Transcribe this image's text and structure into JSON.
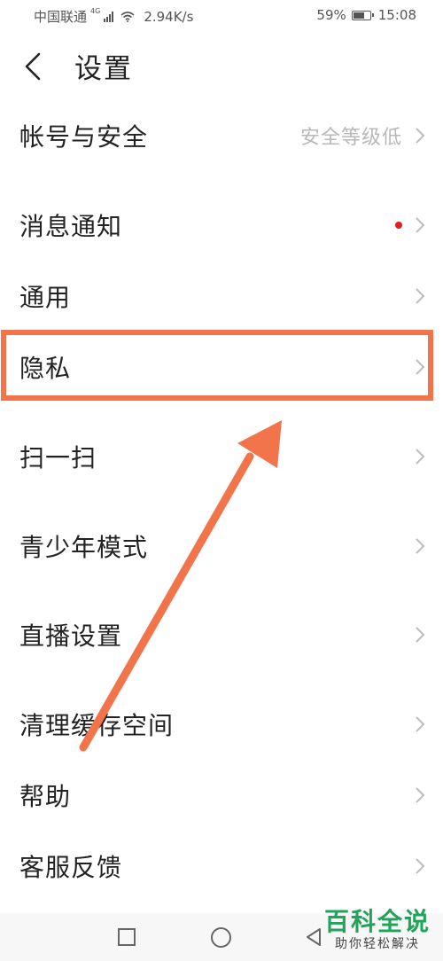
{
  "status_bar": {
    "carrier": "中国联通",
    "network": "4G",
    "speed": "2.94K/s",
    "battery": "59%",
    "time": "15:08"
  },
  "header": {
    "back_icon": "chevron-left-icon",
    "title": "设置"
  },
  "settings": {
    "items": [
      {
        "label": "帐号与安全",
        "value": "安全等级低"
      },
      {
        "label": "消息通知",
        "badge": "red-dot"
      },
      {
        "label": "通用"
      },
      {
        "label": "隐私"
      },
      {
        "label": "扫一扫"
      },
      {
        "label": "青少年模式"
      },
      {
        "label": "直播设置"
      },
      {
        "label": "清理缓存空间"
      },
      {
        "label": "帮助"
      },
      {
        "label": "客服反馈"
      }
    ]
  },
  "annotation": {
    "highlight_color": "#f2744a",
    "highlighted_item": "隐私"
  },
  "nav_bar": {
    "icons": [
      "recents-square-icon",
      "home-circle-icon",
      "back-triangle-icon"
    ]
  },
  "watermark": {
    "title": "百科全说",
    "subtitle": "助你轻松解决"
  }
}
